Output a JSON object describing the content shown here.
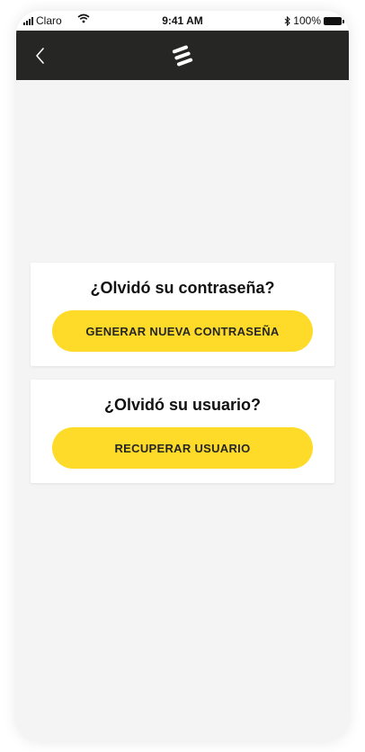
{
  "status_bar": {
    "carrier": "Claro",
    "time": "9:41 AM",
    "battery": "100%"
  },
  "nav": {
    "back_icon": "chevron-left-icon",
    "logo_icon": "brand-logo-icon"
  },
  "recover_password": {
    "title": "¿Olvidó su contraseña?",
    "button": "GENERAR NUEVA CONTRASEÑA"
  },
  "recover_user": {
    "title": "¿Olvidó su usuario?",
    "button": "RECUPERAR USUARIO"
  },
  "colors": {
    "accent": "#fddb28",
    "nav_bg": "#262624",
    "background": "#f4f4f4"
  }
}
